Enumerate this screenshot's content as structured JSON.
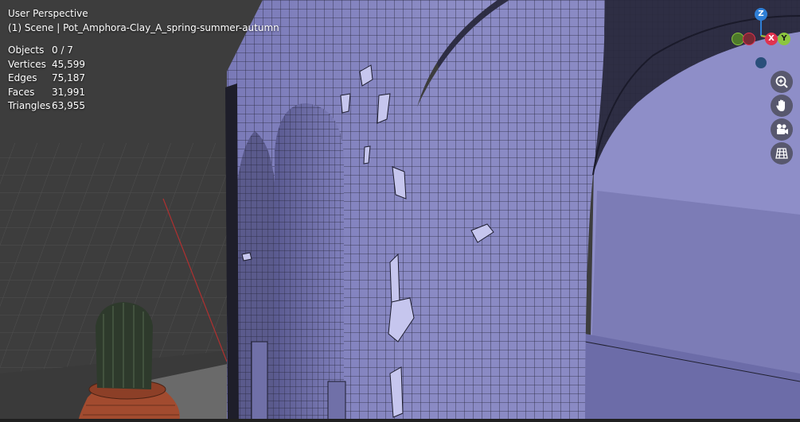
{
  "viewport": {
    "view_name": "User Perspective",
    "scene_line": "(1) Scene | Pot_Amphora-Clay_A_spring-summer-autumn",
    "stats": [
      {
        "label": "Objects",
        "value": "0 / 7"
      },
      {
        "label": "Vertices",
        "value": "45,599"
      },
      {
        "label": "Edges",
        "value": "75,187"
      },
      {
        "label": "Faces",
        "value": "31,991"
      },
      {
        "label": "Triangles",
        "value": "63,955"
      }
    ]
  },
  "gizmo": {
    "z_label": "Z",
    "x_label": "X",
    "y_label": "Y",
    "colors": {
      "z": "#2f7fd6",
      "x": "#e0334f",
      "y": "#8cc63f",
      "neg_y": "#4d7a2a",
      "neg_x": "#7a2a35",
      "neg_z": "#2a4f7a"
    }
  },
  "nav_buttons": [
    {
      "icon": "zoom-icon"
    },
    {
      "icon": "hand-pan-icon"
    },
    {
      "icon": "camera-view-icon"
    },
    {
      "icon": "grid-ortho-icon"
    }
  ],
  "colors": {
    "mesh": "#8888c8",
    "mesh_dark": "#6e6ea8",
    "wire": "#1c1c2e",
    "floor": "#4a4a4a",
    "background": "#3d3d3d",
    "pot": "#a24b2f",
    "cactus": "#2e3a2c"
  }
}
